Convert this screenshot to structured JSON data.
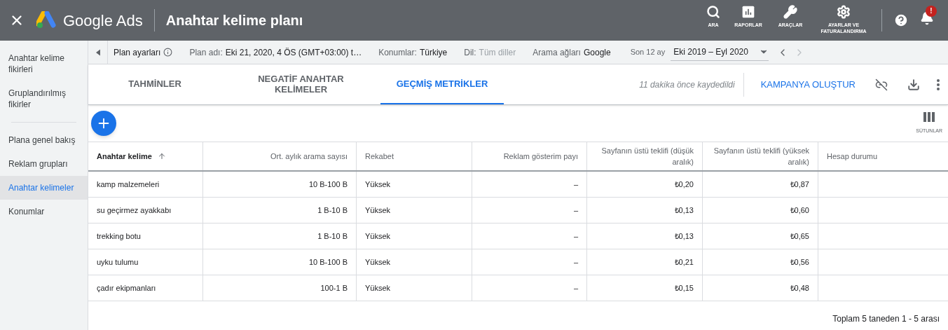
{
  "header": {
    "product": "Google Ads",
    "title": "Anahtar kelime planı",
    "nav": [
      {
        "kind": "search",
        "label": "ARA"
      },
      {
        "kind": "reports",
        "label": "RAPORLAR"
      },
      {
        "kind": "tools",
        "label": "ARAÇLAR"
      },
      {
        "kind": "settings",
        "label": "AYARLAR VE FATURALANDIRMA"
      }
    ],
    "notification_badge": "!"
  },
  "sidebar": {
    "groups": [
      [
        {
          "label": "Anahtar kelime fikirleri",
          "selected": false
        },
        {
          "label": "Gruplandırılmış fikirler",
          "selected": false
        }
      ],
      [
        {
          "label": "Plana genel bakış",
          "selected": false
        },
        {
          "label": "Reklam grupları",
          "selected": false
        },
        {
          "label": "Anahtar kelimeler",
          "selected": true
        },
        {
          "label": "Konumlar",
          "selected": false
        }
      ]
    ]
  },
  "settings_bar": {
    "label": "Plan ayarları",
    "fields": [
      {
        "label": "Plan adı:",
        "value": "Eki 21, 2020, 4 ÖS (GMT+03:00) t…",
        "disabled": false
      },
      {
        "label": "Konumlar:",
        "value": "Türkiye",
        "disabled": false
      },
      {
        "label": "Dil:",
        "value": "Tüm diller",
        "disabled": true
      },
      {
        "label": "Arama ağları",
        "value": "Google",
        "disabled": false
      }
    ],
    "date_range": {
      "label": "Son 12 ay",
      "value": "Eki 2019 – Eyl 2020"
    }
  },
  "tabs": [
    {
      "label": "TAHMİNLER",
      "selected": false
    },
    {
      "label": "NEGATİF ANAHTAR KELİMELER",
      "selected": false
    },
    {
      "label": "GEÇMİŞ METRİKLER",
      "selected": true
    }
  ],
  "saved_note": "11 dakika önce kaydedildi",
  "create_campaign": "KAMPANYA OLUŞTUR",
  "columns_button": "SÜTUNLAR",
  "table": {
    "columns": [
      {
        "label": "Anahtar kelime",
        "sorted": true
      },
      {
        "label": "Ort. aylık arama sayısı",
        "sorted": false
      },
      {
        "label": "Rekabet",
        "sorted": false
      },
      {
        "label": "Reklam gösterim payı",
        "sorted": false
      },
      {
        "label": "Sayfanın üstü teklifi (düşük aralık)",
        "sorted": false
      },
      {
        "label": "Sayfanın üstü teklifi (yüksek aralık)",
        "sorted": false
      },
      {
        "label": "Hesap durumu",
        "sorted": false
      }
    ],
    "rows": [
      [
        "kamp malzemeleri",
        "10 B-100 B",
        "Yüksek",
        "–",
        "₺0,20",
        "₺0,87"
      ],
      [
        "su geçirmez ayakkabı",
        "1 B-10 B",
        "Yüksek",
        "–",
        "₺0,13",
        "₺0,60"
      ],
      [
        "trekking botu",
        "1 B-10 B",
        "Yüksek",
        "–",
        "₺0,13",
        "₺0,65"
      ],
      [
        "uyku tulumu",
        "10 B-100 B",
        "Yüksek",
        "–",
        "₺0,21",
        "₺0,56"
      ],
      [
        "çadır ekipmanları",
        "100-1 B",
        "Yüksek",
        "–",
        "₺0,15",
        "₺0,48"
      ]
    ],
    "pagination": "Toplam 5 taneden 1 - 5 arası"
  }
}
